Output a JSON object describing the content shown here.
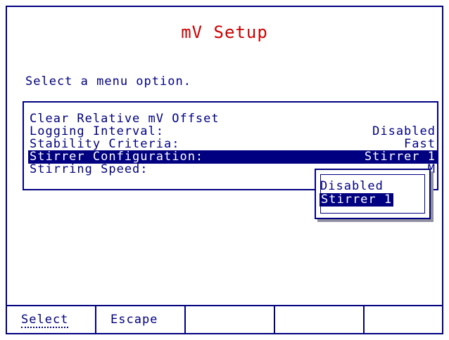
{
  "title": "mV Setup",
  "prompt": "Select a menu option.",
  "menu": {
    "items": [
      {
        "label": "Clear Relative mV Offset",
        "value": ""
      },
      {
        "label": "Logging Interval:",
        "value": "Disabled"
      },
      {
        "label": "Stability Criteria:",
        "value": "Fast"
      },
      {
        "label": "Stirrer Configuration:",
        "value": "Stirrer 1"
      },
      {
        "label": "Stirring Speed:",
        "value": "M"
      }
    ],
    "selected_index": 3
  },
  "popup": {
    "options": [
      "Disabled",
      "Stirrer 1"
    ],
    "selected_index": 1
  },
  "softkeys": [
    "Select",
    "Escape",
    "",
    "",
    ""
  ],
  "colors": {
    "primary": "#000080",
    "title": "#cc0000",
    "background": "#ffffff"
  }
}
